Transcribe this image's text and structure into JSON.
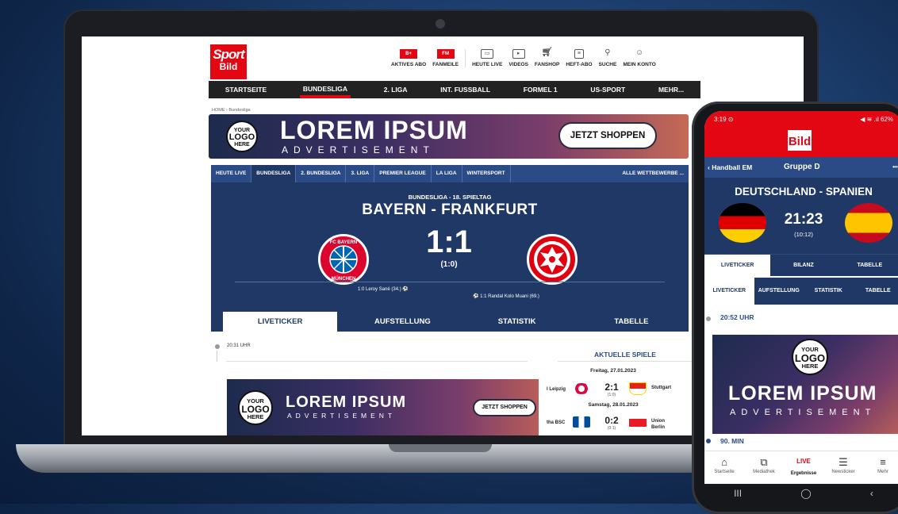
{
  "site": {
    "logo_line1": "Sport",
    "logo_line2": "Bild",
    "top_nav": [
      {
        "label": "AKTIVES ABO",
        "icon": "bild-plus-icon"
      },
      {
        "label": "FANMEILE",
        "icon": "fanmeile-icon"
      },
      {
        "label": "HEUTE LIVE",
        "icon": "tv-icon"
      },
      {
        "label": "VIDEOS",
        "icon": "video-icon"
      },
      {
        "label": "FANSHOP",
        "icon": "cart-icon"
      },
      {
        "label": "HEFT-ABO",
        "icon": "magazine-icon"
      },
      {
        "label": "SUCHE",
        "icon": "search-icon"
      },
      {
        "label": "MEIN KONTO",
        "icon": "account-icon"
      }
    ],
    "main_nav": [
      "STARTSEITE",
      "BUNDESLIGA",
      "2. LIGA",
      "INT. FUSSBALL",
      "FORMEL 1",
      "US-SPORT",
      "MEHR..."
    ],
    "breadcrumb": "HOME › Bundesliga",
    "ad": {
      "logo_line1": "YOUR",
      "logo_line2": "LOGO",
      "logo_line3": "HERE",
      "title": "LOREM IPSUM",
      "subtitle": "ADVERTISEMENT",
      "button": "JETZT SHOPPEN"
    },
    "sub_tabs": [
      "HEUTE LIVE",
      "BUNDESLIGA",
      "2. BUNDESLIGA",
      "3. LIGA",
      "PREMIER LEAGUE",
      "LA LIGA",
      "WINTERSPORT",
      "ALLE WETTBEWERBE ..."
    ],
    "match": {
      "league": "BUNDESLIGA - 18. SPIELTAG",
      "title": "BAYERN - FRANKFURT",
      "score": "1:1",
      "halftime": "(1:0)",
      "home_crest_text": "FC BAYERN MÜNCHEN",
      "goal_home": "1:0 Leroy Sané (34.) ⚽",
      "goal_away": "⚽ 1:1 Randal Kolo Muani (69.)"
    },
    "match_tabs": [
      "LIVETICKER",
      "AUFSTELLUNG",
      "STATISTIK",
      "TABELLE"
    ],
    "ticker_time": "20:31 UHR",
    "aktuelle_spiele": {
      "header": "AKTUELLE SPIELE",
      "day1": "Freitag, 27.01.2023",
      "game1": {
        "home": "l Leipzig",
        "score": "2:1",
        "half": "(1:0)",
        "away": "Stuttgart"
      },
      "day2": "Samstag, 28.01.2023",
      "game2": {
        "home": "tha BSC",
        "score": "0:2",
        "half": "(0:1)",
        "away_line1": "Union",
        "away_line2": "Berlin"
      }
    }
  },
  "phone": {
    "status_time": "3:19 ⊙",
    "status_right": "◀ ≋ .ıl 62%",
    "logo": "Bild",
    "back_label": "‹ Handball EM",
    "group": "Gruppe D",
    "more": "•••",
    "match_title": "DEUTSCHLAND - SPANIEN",
    "score": "21:23",
    "halftime": "(10:12)",
    "tabs1": [
      "LIVETICKER",
      "BILANZ",
      "TABELLE"
    ],
    "tabs2": [
      "LIVETICKER",
      "AUFSTELLUNG",
      "STATISTIK",
      "TABELLE"
    ],
    "ticker_time": "20:52 UHR",
    "ad": {
      "logo_line1": "YOUR",
      "logo_line2": "LOGO",
      "logo_line3": "HERE",
      "title": "LOREM IPSUM",
      "subtitle": "ADVERTISEMENT"
    },
    "minute": "90. MIN",
    "bottom_nav": [
      {
        "label": "Startseite",
        "icon": "home-icon"
      },
      {
        "label": "Mediathek",
        "icon": "media-icon"
      },
      {
        "label": "Ergebnisse",
        "live": "LIVE"
      },
      {
        "label": "Newsticker",
        "icon": "news-icon"
      },
      {
        "label": "Mehr",
        "icon": "menu-icon"
      }
    ],
    "system_nav": [
      "III",
      "◯",
      "‹"
    ]
  },
  "colors": {
    "bild_red": "#e30613",
    "navy": "#1f3866",
    "tab_blue": "#2a4b85",
    "bayern_red": "#dc052d",
    "eintracht_red": "#e1000f",
    "germany_black": "#000000",
    "germany_red": "#dd0000",
    "germany_gold": "#ffce00",
    "spain_red": "#c60b1e",
    "spain_yellow": "#ffc400"
  }
}
